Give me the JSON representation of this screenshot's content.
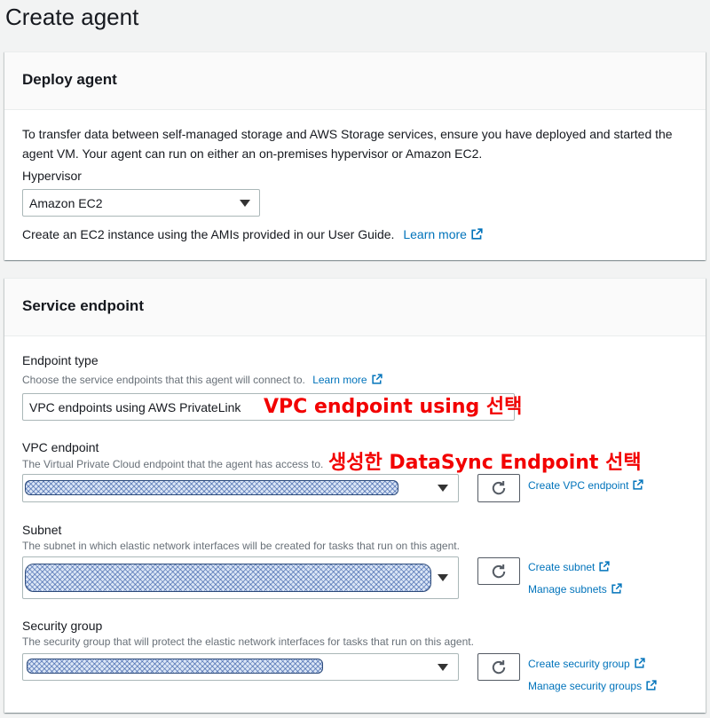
{
  "page": {
    "title": "Create agent"
  },
  "deploy_agent": {
    "header": "Deploy agent",
    "description": "To transfer data between self-managed storage and AWS Storage services, ensure you have deployed and started the agent VM. Your agent can run on either an on-premises hypervisor or Amazon EC2.",
    "hypervisor": {
      "label": "Hypervisor",
      "value": "Amazon EC2"
    },
    "ec2_note": "Create an EC2 instance using the AMIs provided in our User Guide.",
    "learn_more": "Learn more"
  },
  "service_endpoint": {
    "header": "Service endpoint",
    "endpoint_type": {
      "label": "Endpoint type",
      "description": "Choose the service endpoints that this agent will connect to.",
      "learn_more": "Learn more",
      "value": "VPC endpoints using AWS PrivateLink"
    },
    "vpc_endpoint": {
      "label": "VPC endpoint",
      "description": "The Virtual Private Cloud endpoint that the agent has access to.",
      "create_link": "Create VPC endpoint"
    },
    "subnet": {
      "label": "Subnet",
      "description": "The subnet in which elastic network interfaces will be created for tasks that run on this agent.",
      "create_link": "Create subnet",
      "manage_link": "Manage subnets"
    },
    "security_group": {
      "label": "Security group",
      "description": "The security group that will protect the elastic network interfaces for tasks that run on this agent.",
      "create_link": "Create security group",
      "manage_link": "Manage security groups"
    }
  },
  "annotations": {
    "endpoint_type": "VPC endpoint using 선택",
    "vpc_endpoint": "생성한 DataSync Endpoint 선택"
  },
  "icons": {
    "external_link": "external-link-icon",
    "refresh": "refresh-icon",
    "caret": "caret-down-icon"
  },
  "colors": {
    "link": "#0073bb",
    "text": "#16191f",
    "secondary_text": "#687078",
    "annotation": "#f20000",
    "page_background": "#f2f3f3",
    "panel_header": "#fafafa",
    "redaction": "#dbe6f6"
  }
}
